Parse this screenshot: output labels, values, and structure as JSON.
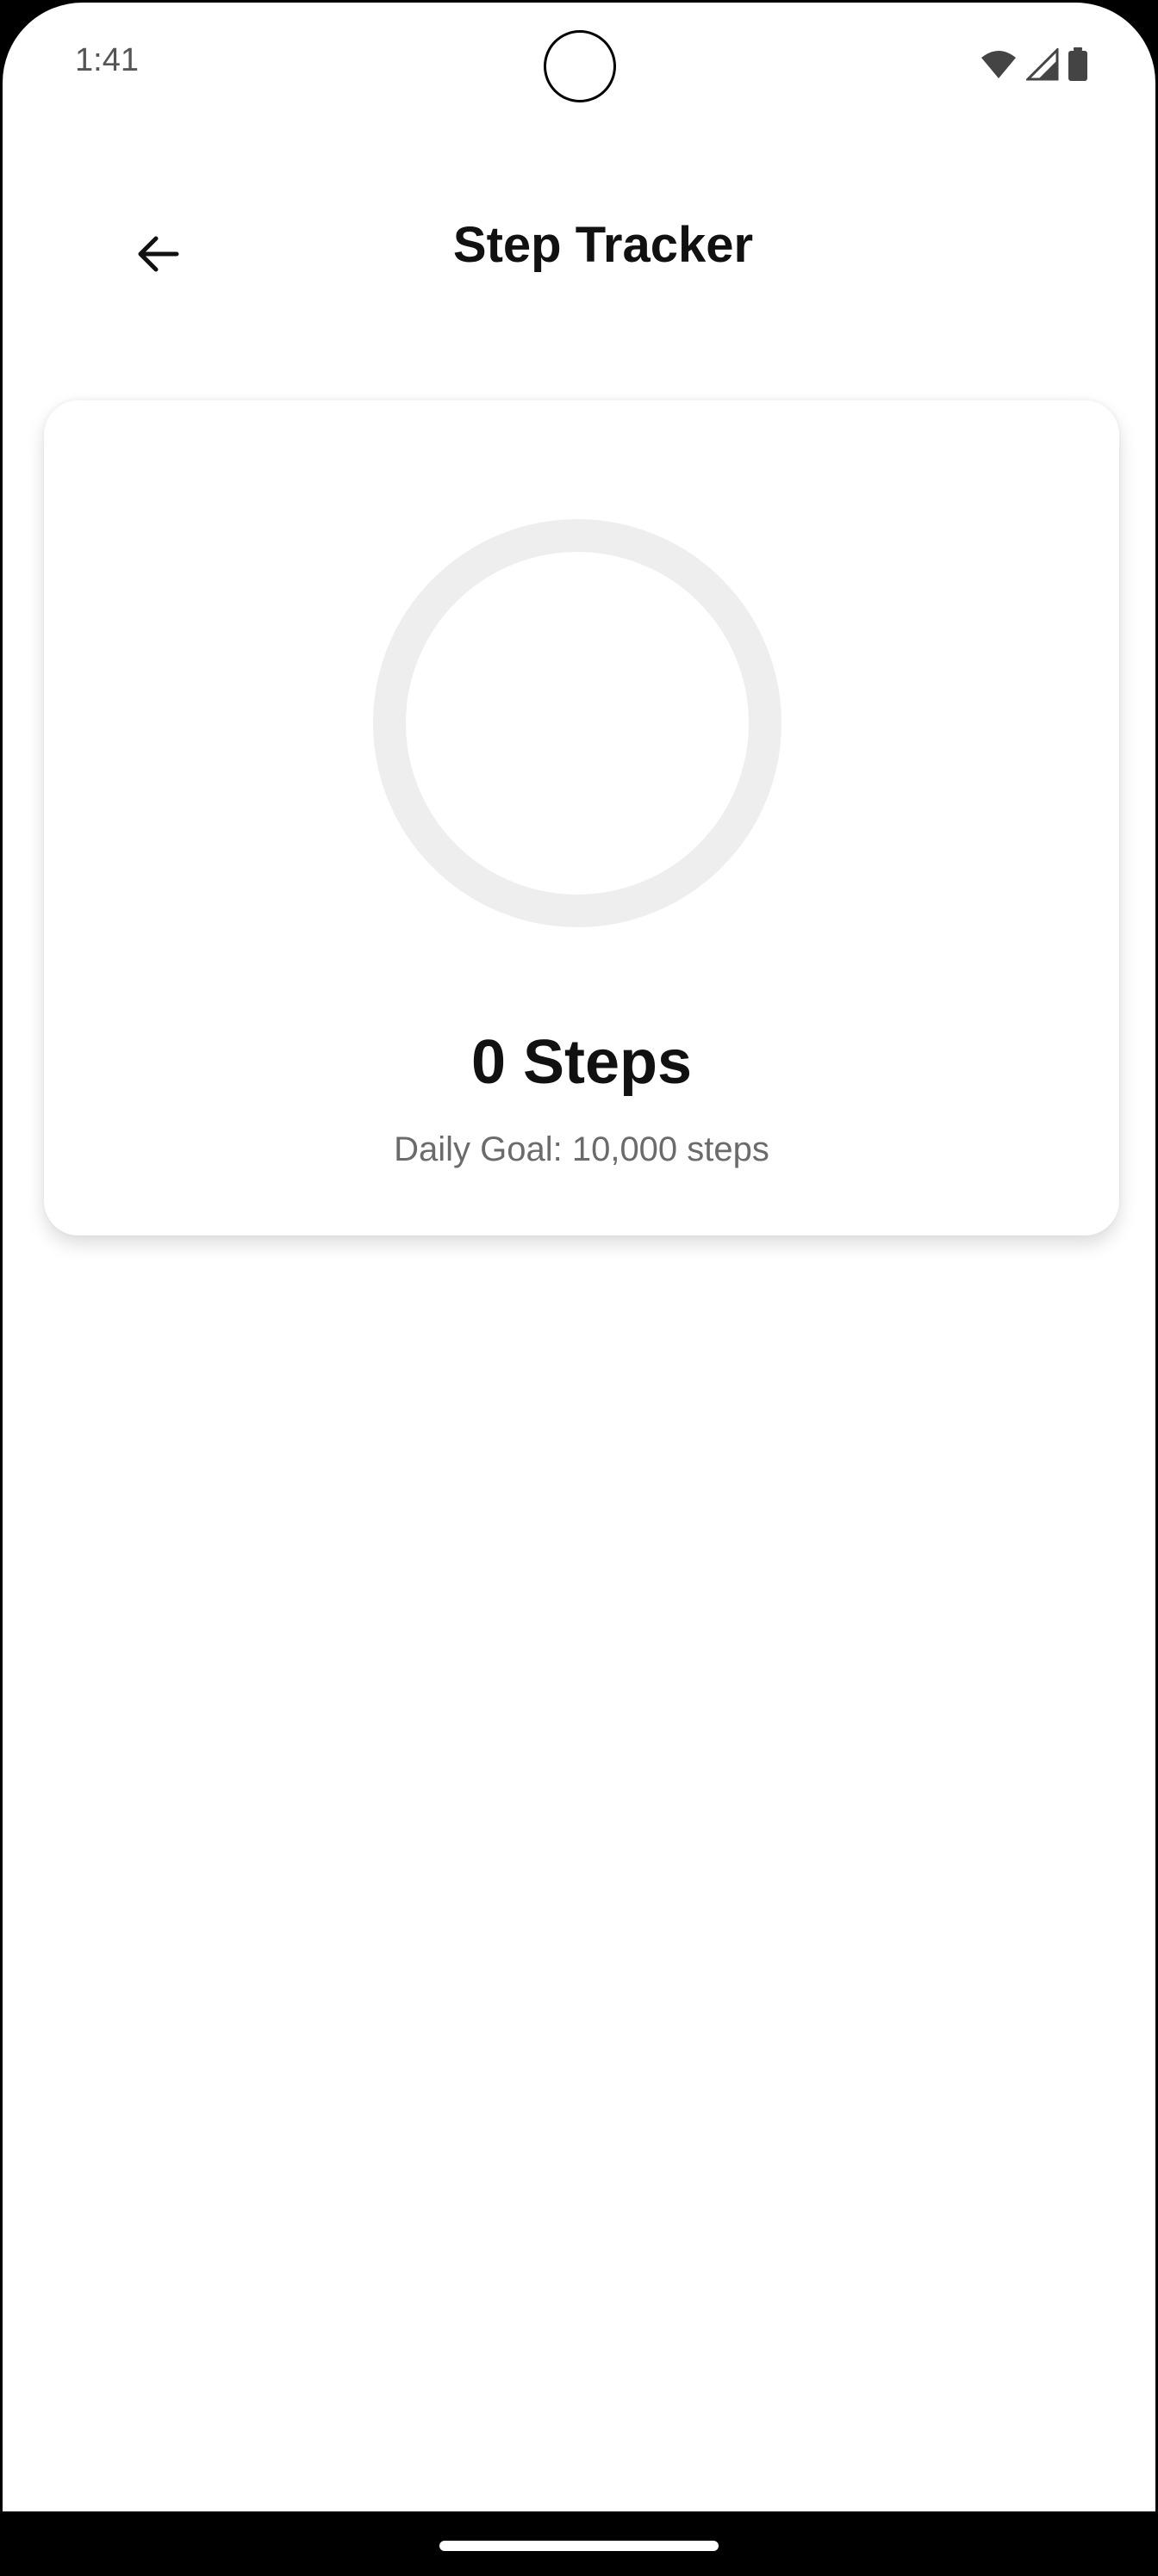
{
  "status_bar": {
    "time": "1:41",
    "icons": [
      "wifi-icon",
      "cell-signal-icon",
      "battery-icon"
    ]
  },
  "app_bar": {
    "title": "Step Tracker",
    "back_icon": "arrow-back-icon"
  },
  "tracker": {
    "steps_label": "0 Steps",
    "goal_label": "Daily Goal: 10,000 steps",
    "progress": 0,
    "ring_track_color": "#EEEEEE"
  }
}
